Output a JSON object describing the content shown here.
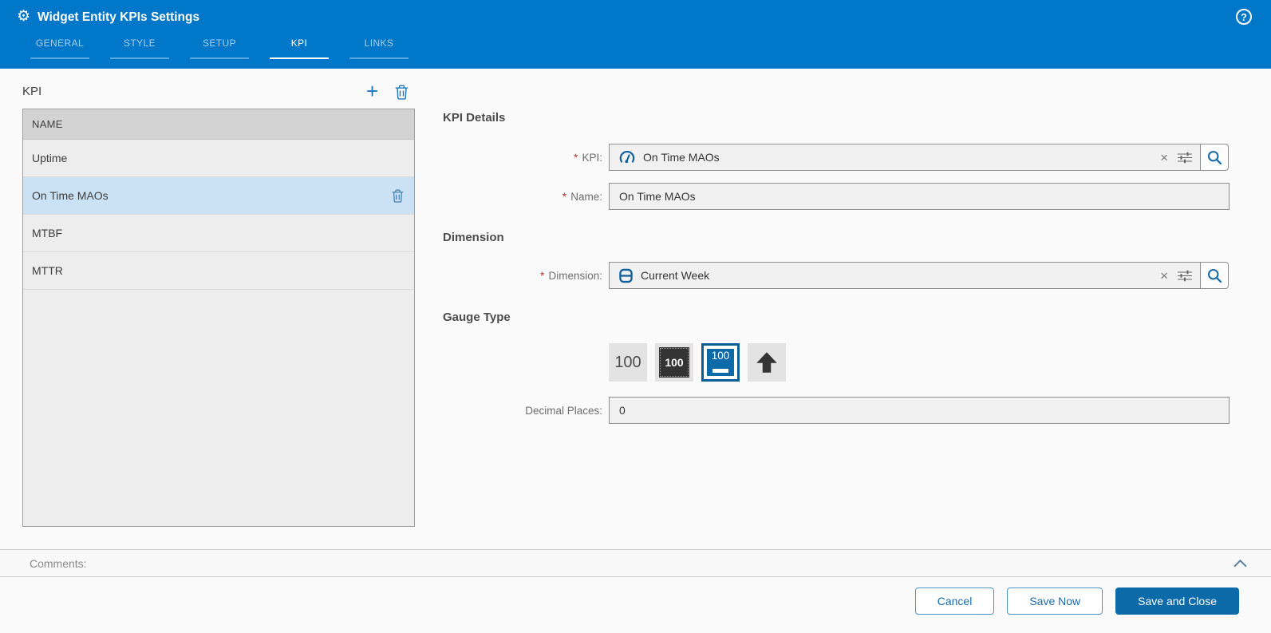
{
  "colors": {
    "header_blue": "#0077c8",
    "accent_blue": "#1b6ca8",
    "selected_row_blue": "#cbe2f4",
    "primary_button_blue": "#0d6aa8"
  },
  "icons": {
    "gear_glyph": "⚙",
    "help_glyph": "?",
    "plus_glyph": "+",
    "clear_glyph": "×"
  },
  "header": {
    "title": "Widget Entity KPIs Settings",
    "tabs": [
      {
        "label": "GENERAL",
        "active": false
      },
      {
        "label": "STYLE",
        "active": false
      },
      {
        "label": "SETUP",
        "active": false
      },
      {
        "label": "KPI",
        "active": true
      },
      {
        "label": "LINKS",
        "active": false
      }
    ]
  },
  "kpi_panel": {
    "title": "KPI",
    "column_header": "NAME",
    "items": [
      {
        "name": "Uptime",
        "selected": false
      },
      {
        "name": "On Time MAOs",
        "selected": true
      },
      {
        "name": "MTBF",
        "selected": false
      },
      {
        "name": "MTTR",
        "selected": false
      }
    ]
  },
  "form": {
    "required_marker": "*",
    "kpi_details_title": "KPI Details",
    "kpi_label": "KPI:",
    "kpi_value": "On Time MAOs",
    "name_label": "Name:",
    "name_value": "On Time MAOs",
    "dimension_title": "Dimension",
    "dimension_label": "Dimension:",
    "dimension_value": "Current Week",
    "gauge_type_title": "Gauge Type",
    "gauge_types": [
      {
        "name": "number",
        "label": "100",
        "selected": false
      },
      {
        "name": "number-inverted",
        "label": "100",
        "selected": false
      },
      {
        "name": "number-with-bar",
        "label": "100",
        "selected": true
      },
      {
        "name": "arrow-indicator",
        "label": "",
        "selected": false
      }
    ],
    "decimal_label": "Decimal Places:",
    "decimal_value": "0"
  },
  "comments": {
    "label": "Comments:"
  },
  "footer": {
    "cancel": "Cancel",
    "save_now": "Save Now",
    "save_and_close": "Save and Close"
  }
}
